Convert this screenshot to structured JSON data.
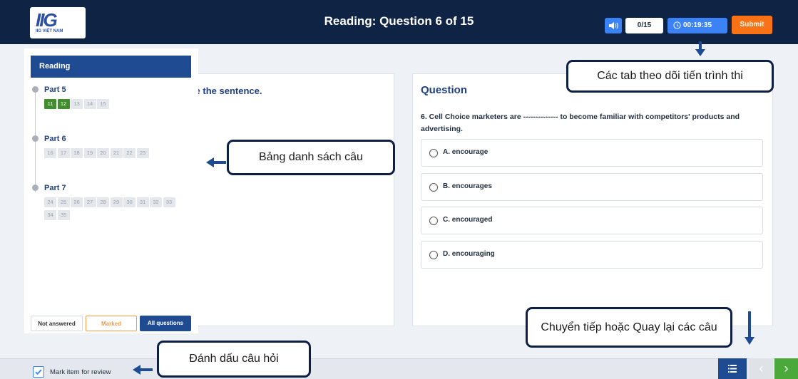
{
  "header": {
    "logo_mark": "IIG",
    "logo_sub": "IIG VIỆT NAM",
    "title": "Reading: Question 6 of 15",
    "volume_icon": "speaker-icon",
    "answered_count": "0/15",
    "timer": "00:19:35",
    "timer_icon": "clock-icon",
    "submit_label": "Submit"
  },
  "navigator": {
    "header": "Reading",
    "parts": [
      {
        "label": "Part 5",
        "questions": [
          "11",
          "12",
          "13",
          "14",
          "15"
        ],
        "answered": [
          "11",
          "12"
        ]
      },
      {
        "label": "Part 6",
        "questions": [
          "16",
          "17",
          "18",
          "19",
          "20",
          "21",
          "22",
          "23"
        ],
        "answered": []
      },
      {
        "label": "Part 7",
        "questions": [
          "24",
          "25",
          "26",
          "27",
          "28",
          "29",
          "30",
          "31",
          "32",
          "33",
          "34",
          "35"
        ],
        "answered": []
      }
    ],
    "filters": [
      "Not answered",
      "Marked",
      "All questions"
    ]
  },
  "left_panel": {
    "instruction": "ete the sentence."
  },
  "question": {
    "heading": "Question",
    "text": "6. Cell Choice marketers are -------------- to become familiar with competitors' products and advertising.",
    "options": [
      "A. encourage",
      "B. encourages",
      "C. encouraged",
      "D. encouraging"
    ]
  },
  "footer": {
    "mark_label": "Mark item for review",
    "mark_checked": true,
    "list_icon": "list-icon",
    "prev_icon": "chevron-left-icon",
    "next_icon": "chevron-right-icon"
  },
  "annotations": {
    "progress_tabs": "Các tab theo dõi tiến trình thi",
    "question_list": "Bảng danh sách câu",
    "navigation": "Chuyển tiếp hoặc Quay lại các câu",
    "mark_question": "Đánh dấu câu hỏi"
  },
  "colors": {
    "header_bg": "#0f2344",
    "accent_blue": "#3b82f6",
    "submit_orange": "#f97316",
    "answered_green": "#3f8f2c",
    "nav_blue": "#1e4b91",
    "next_green": "#4ba83a"
  }
}
